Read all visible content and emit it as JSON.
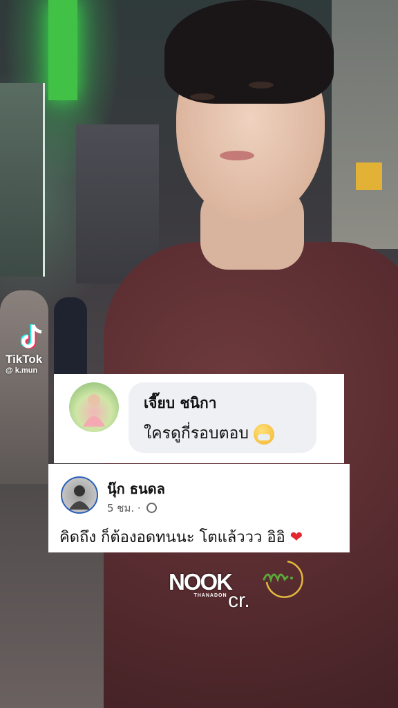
{
  "watermark": {
    "brand": "TikTok",
    "handle": "@ k.mun"
  },
  "comment1": {
    "author": "เจี๊ยบ ชนิกา",
    "text": "ใครดูกี่รอบตอบ"
  },
  "comment2": {
    "author": "นุ๊ก ธนดล",
    "time": "5 ชม. ·",
    "text": "คิดถึง ก็ต้องอดทนนะ โตแล้ววว อิอิ"
  },
  "credit": {
    "logo_main": "NOOK",
    "logo_sub": "THANADON",
    "cr": "cr."
  },
  "colors": {
    "sweater": "#5a2d31",
    "avatar_ring": "#2a5fb8",
    "heart": "#e3262f",
    "signature_green": "#5aa83a",
    "signature_gold": "#e2b740"
  }
}
